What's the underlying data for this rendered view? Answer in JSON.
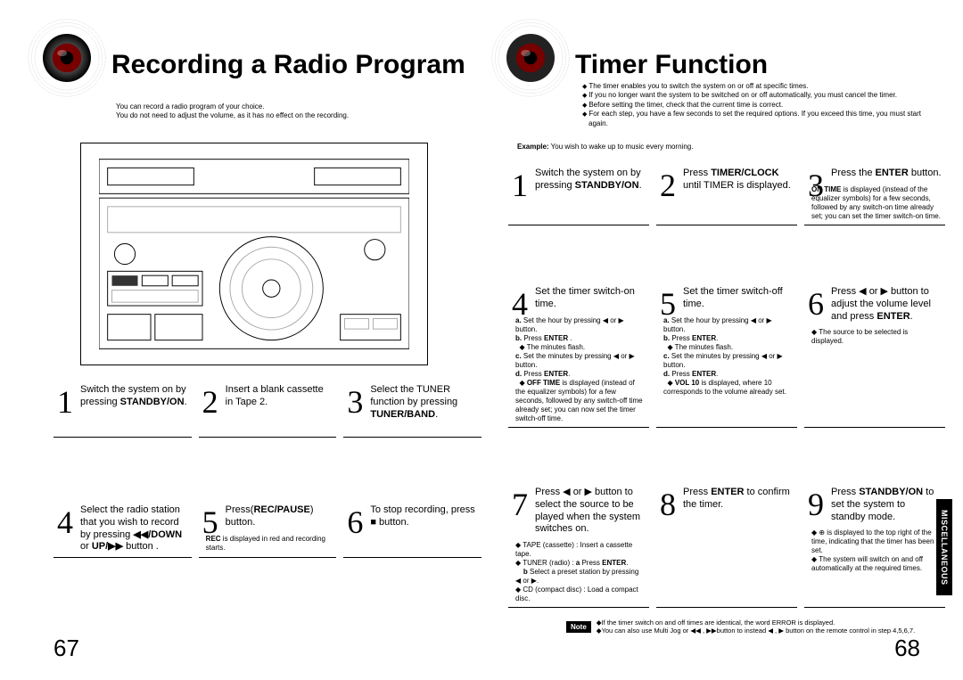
{
  "left": {
    "title": "Recording a Radio Program",
    "intro": [
      "You can record a radio program of your choice.",
      "You do not need to adjust the volume, as it has no effect on the recording."
    ],
    "steps": [
      {
        "num": "1",
        "text": "Switch the system on by pressing <b>STANDBY/ON</b>."
      },
      {
        "num": "2",
        "text": "Insert a blank cassette in Tape 2."
      },
      {
        "num": "3",
        "text": "Select the TUNER function by pressing <b>TUNER/BAND</b>."
      },
      {
        "num": "4",
        "text": "Select the radio station that you wish to record by pressing <b>◀◀/DOWN</b> or <b>UP/▶▶</b> button ."
      },
      {
        "num": "5",
        "text": "Press(<b>REC/PAUSE</b>) button.",
        "sub": "<b>REC</b> is displayed in red and recording starts."
      },
      {
        "num": "6",
        "text": "To stop recording, press ■ button."
      }
    ],
    "pagenum": "67"
  },
  "right": {
    "title": "Timer Function",
    "intro": [
      "The timer enables you to switch the system on or off at specific times.",
      "If you no longer want the system to be switched on or off automatically, you must cancel the timer.",
      "Before setting the timer, check that the current time is correct.",
      "For each step, you have a few seconds to set the required options. If you exceed this time, you must start again."
    ],
    "example": "You wish to wake up to music every morning.",
    "steps": [
      {
        "num": "1",
        "text": "Switch the system on by pressing <b>STANDBY/ON</b>."
      },
      {
        "num": "2",
        "text": "Press <b>TIMER/CLOCK</b> until TIMER is displayed."
      },
      {
        "num": "3",
        "text": "Press the <b>ENTER</b> button.",
        "sub": "<b>ON TIME</b> is displayed (instead of the equalizer symbols) for a few seconds, followed by any switch-on time already set; you can set the timer switch-on time."
      },
      {
        "num": "4",
        "text": "Set the timer switch-on time.",
        "sub": "<b>a.</b> Set the hour by pressing ◀ or ▶ button.<br><b>b.</b> Press <b>ENTER</b> .<br>&nbsp;&nbsp;◆ The minutes flash.<br><b>c.</b> Set the minutes by pressing ◀ or ▶ button.<br><b>d.</b> Press <b>ENTER</b>.<br>&nbsp;&nbsp;◆ <b>OFF TIME</b> is displayed (instead of the equalizer symbols) for a few seconds, followed by any switch-off time already set; you can now set the timer switch-off time."
      },
      {
        "num": "5",
        "text": "Set the timer switch-off time.",
        "sub": "<b>a.</b> Set the hour by pressing ◀ or ▶ button.<br><b>b.</b> Press <b>ENTER</b>.<br>&nbsp;&nbsp;◆ The minutes flash.<br><b>c.</b> Set the minutes by pressing ◀ or ▶ button.<br><b>d.</b> Press <b>ENTER</b>.<br>&nbsp;&nbsp;◆ <b>VOL 10</b> is displayed, where 10 corresponds to the volume already set."
      },
      {
        "num": "6",
        "text": "Press ◀ or ▶ button to adjust the volume level and press <b>ENTER</b>.",
        "sub": "◆ The source to be selected is displayed."
      },
      {
        "num": "7",
        "text": "Press ◀ or ▶ button to select the source to be played when the system switches on.",
        "sub": "◆ TAPE (cassette) : Insert a cassette tape.<br>◆ TUNER (radio) : <b>a</b> Press <b>ENTER</b>.<br>&nbsp;&nbsp;&nbsp;&nbsp;<b>b</b> Select a preset station by pressing ◀ or ▶.<br>◆ CD (compact disc) : Load a compact disc."
      },
      {
        "num": "8",
        "text": "Press <b>ENTER</b> to confirm the timer."
      },
      {
        "num": "9",
        "text": "Press <b>STANDBY/ON</b> to set the system to standby mode.",
        "sub": "◆ ⊕ is displayed to the top right of the time, indicating that the timer has been set.<br>◆ The system will switch on and off automatically at the required times."
      }
    ],
    "notes": [
      "If the timer switch on and off times are identical, the word ERROR is displayed.",
      "You can also use Multi Jog or ◀◀ , ▶▶button to instead ◀ , ▶ button on the remote control in step 4,5,6,7."
    ],
    "noteLabel": "Note",
    "sideTab": "MISCELLANEOUS",
    "pagenum": "68"
  }
}
